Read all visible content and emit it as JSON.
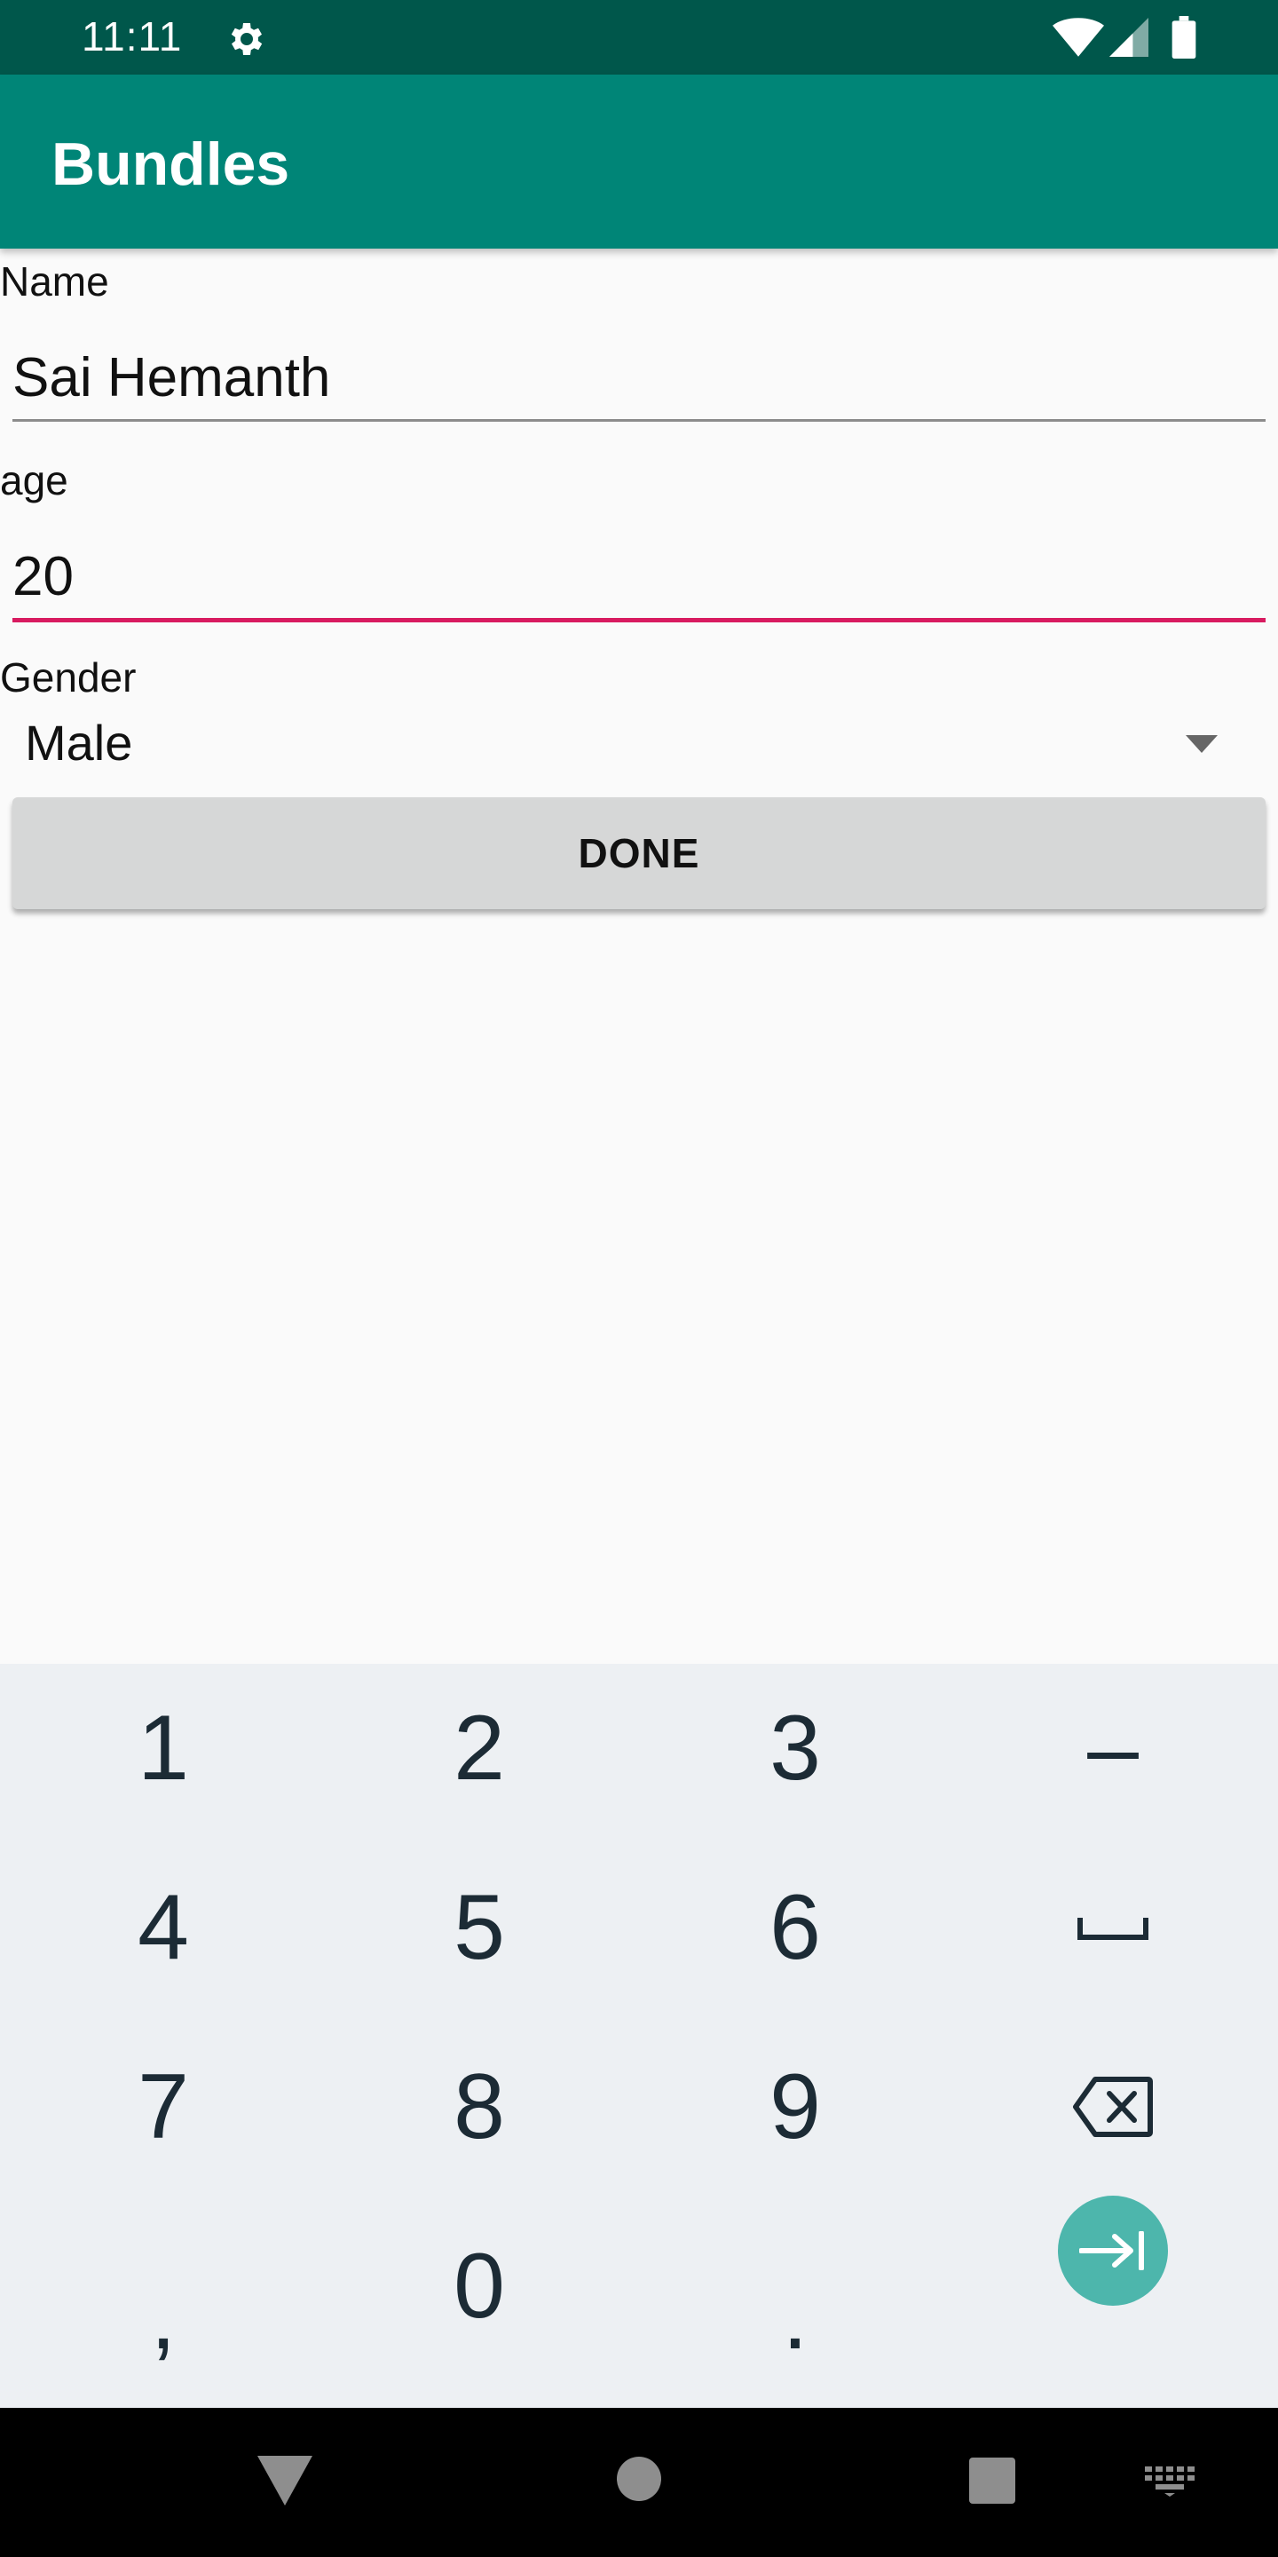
{
  "status_bar": {
    "time": "11:11",
    "icons": [
      "gear-icon",
      "wifi-icon",
      "signal-icon",
      "battery-icon"
    ]
  },
  "app_bar": {
    "title": "Bundles"
  },
  "form": {
    "name_label": "Name",
    "name_value": "Sai Hemanth",
    "age_label": "age",
    "age_value": "20",
    "gender_label": "Gender",
    "gender_selected": "Male",
    "done_label": "DONE"
  },
  "keyboard": {
    "rows": [
      [
        "1",
        "2",
        "3",
        "–"
      ],
      [
        "4",
        "5",
        "6",
        "space-icon"
      ],
      [
        "7",
        "8",
        "9",
        "backspace-icon"
      ],
      [
        ",",
        "0",
        ".",
        "next-field-icon"
      ]
    ]
  },
  "nav_bar": {
    "icons": [
      "back-icon",
      "home-icon",
      "recents-icon",
      "keyboard-switch-icon"
    ]
  },
  "colors": {
    "status_bar": "#00574b",
    "app_bar": "#008577",
    "accent": "#d81b60",
    "enter_key": "#4db6ac"
  }
}
